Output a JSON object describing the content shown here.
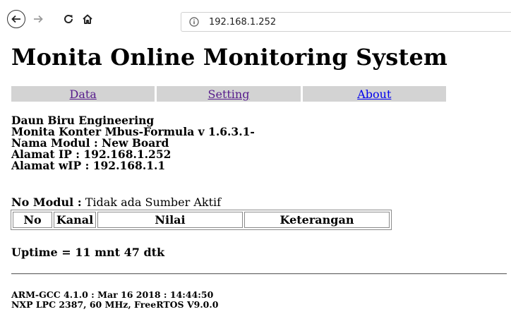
{
  "browser": {
    "url": "192.168.1.252",
    "icons": [
      "back-arrow-icon",
      "forward-arrow-icon",
      "reload-icon",
      "home-icon",
      "info-icon"
    ]
  },
  "page": {
    "title": "Monita Online Monitoring System",
    "menu": [
      {
        "label": "Data"
      },
      {
        "label": "Setting"
      },
      {
        "label": "About"
      }
    ],
    "info_lines": [
      "Daun Biru Engineering",
      "Monita Konter Mbus-Formula v 1.6.3.1-",
      "Nama Modul : New Board",
      "Alamat IP : 192.168.1.252",
      "Alamat wIP : 192.168.1.1"
    ],
    "modul": {
      "label": "No Modul :",
      "value": "Tidak ada Sumber Aktif"
    },
    "table": {
      "headers": [
        "No",
        "Kanal",
        "Nilai",
        "Keterangan"
      ]
    },
    "uptime": "Uptime = 11 mnt 47 dtk",
    "footer": [
      "ARM-GCC 4.1.0 : Mar 16 2018 : 14:44:50",
      "NXP LPC 2387, 60 MHz, FreeRTOS V9.0.0"
    ]
  }
}
